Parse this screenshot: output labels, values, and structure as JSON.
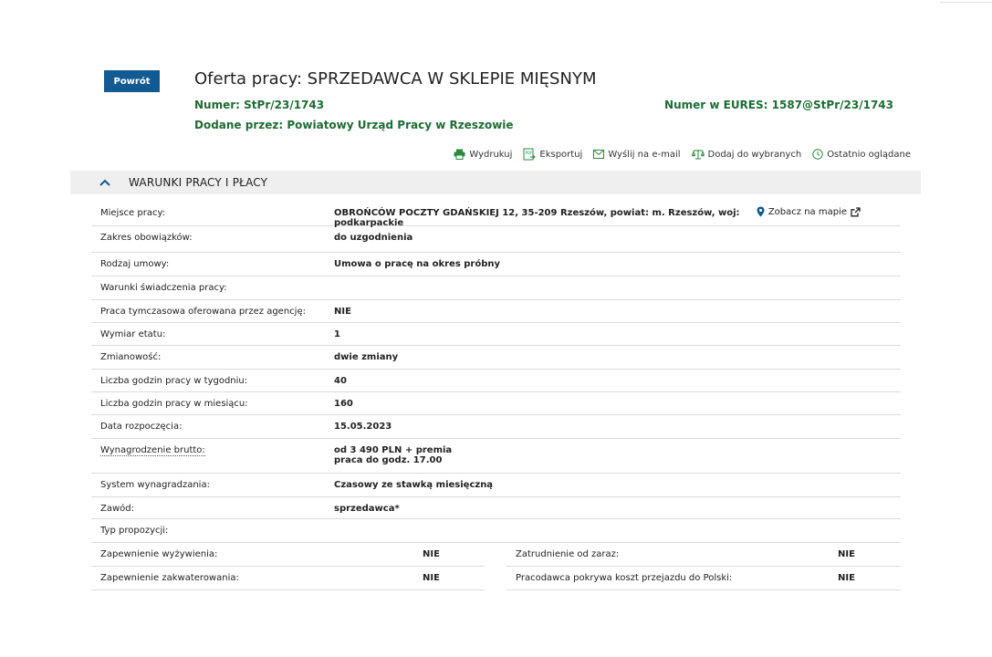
{
  "header": {
    "back_label": "Powrót",
    "title": "Oferta pracy: SPRZEDAWCA W SKLEPIE MIĘSNYM",
    "number_label": "Numer:",
    "number_value": "StPr/23/1743",
    "eures_label": "Numer w EURES:",
    "eures_value": "1587@StPr/23/1743",
    "added_label": "Dodane przez:",
    "added_value": "Powiatowy Urząd Pracy w Rzeszowie"
  },
  "actions": [
    {
      "label": "Wydrukuj",
      "icon": "printer-icon"
    },
    {
      "label": "Eksportuj",
      "icon": "pdf-export-icon"
    },
    {
      "label": "Wyślij na e-mail",
      "icon": "envelope-icon"
    },
    {
      "label": "Dodaj do wybranych",
      "icon": "scales-icon"
    },
    {
      "label": "Ostatnio oglądane",
      "icon": "clock-icon"
    }
  ],
  "section": {
    "title": "WARUNKI PRACY I PŁACY"
  },
  "rows": [
    {
      "label": "Miejsce pracy:",
      "value": "OBROŃCÓW POCZTY GDAŃSKIEJ 12, 35-209 Rzeszów, powiat: m. Rzeszów, woj: podkarpackie",
      "map_label": "Zobacz na mapie"
    },
    {
      "label": "Zakres obowiązków:",
      "value": "do uzgodnienia"
    },
    {
      "label": "Rodzaj umowy:",
      "value": "Umowa o pracę na okres próbny"
    },
    {
      "label": "Warunki świadczenia pracy:",
      "value": ""
    },
    {
      "label": "Praca tymczasowa oferowana przez agencję:",
      "value": "NIE"
    },
    {
      "label": "Wymiar etatu:",
      "value": "1"
    },
    {
      "label": "Zmianowość:",
      "value": "dwie zmiany"
    },
    {
      "label": "Liczba godzin pracy w tygodniu:",
      "value": "40"
    },
    {
      "label": "Liczba godzin pracy w miesiącu:",
      "value": "160"
    },
    {
      "label": "Data rozpoczęcia:",
      "value": "15.05.2023"
    },
    {
      "label": "Wynagrodzenie brutto:",
      "value": "od 3 490 PLN + premia",
      "value2": "praca do godz. 17.00"
    },
    {
      "label": "System wynagradzania:",
      "value": "Czasowy ze stawką miesięczną"
    },
    {
      "label": "Zawód:",
      "value": "sprzedawca*"
    },
    {
      "label": "Typ propozycji:",
      "value": ""
    }
  ],
  "half_rows": [
    {
      "label": "Zapewnienie wyżywienia:",
      "value": "NIE"
    },
    {
      "label": "Zatrudnienie od zaraz:",
      "value": "NIE"
    },
    {
      "label": "Zapewnienie zakwaterowania:",
      "value": "NIE"
    },
    {
      "label": "Pracodawca pokrywa koszt przejazdu do Polski:",
      "value": "NIE"
    }
  ],
  "colors": {
    "accent_blue": "#135a93",
    "green_text": "#1f6b34",
    "section_bg": "#efefef"
  }
}
